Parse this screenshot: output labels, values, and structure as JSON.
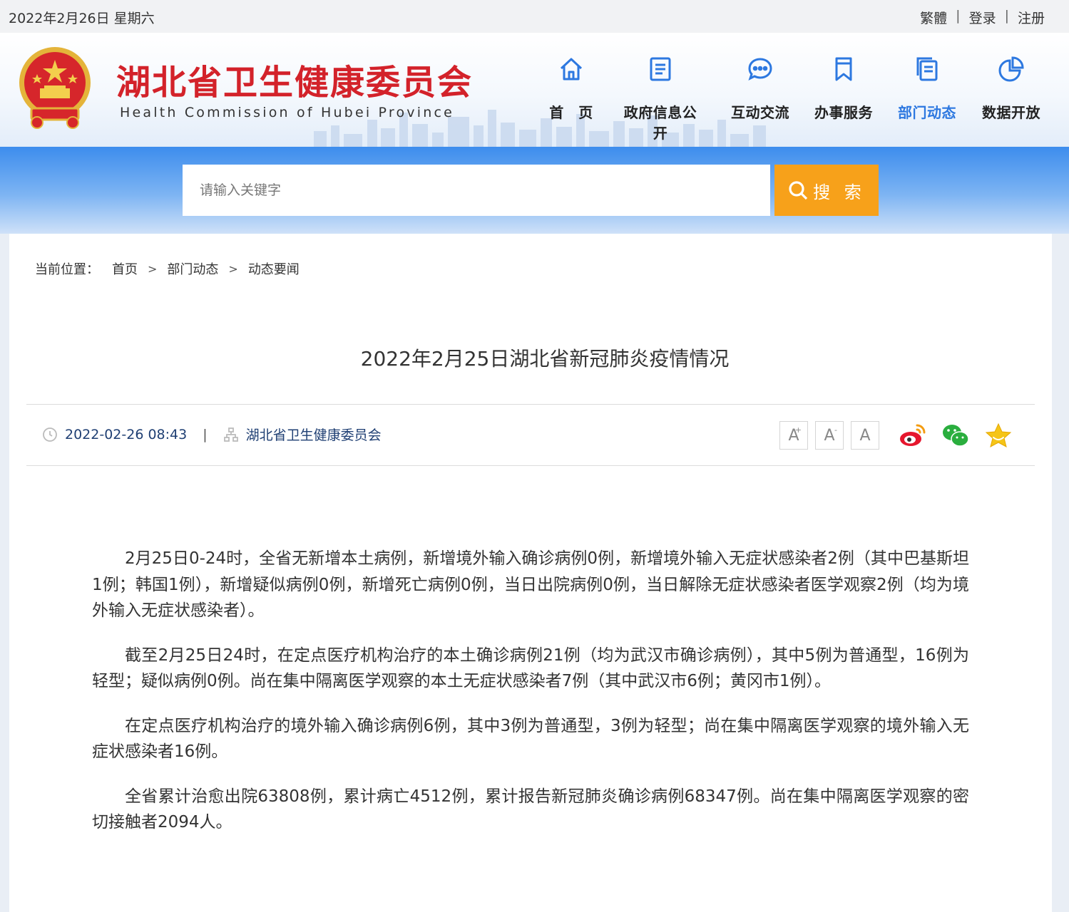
{
  "topbar": {
    "date": "2022年2月26日 星期六",
    "traditional": "繁體",
    "login": "登录",
    "register": "注册"
  },
  "header": {
    "title": "湖北省卫生健康委员会",
    "subtitle": "Health Commission of Hubei Province",
    "brand_color": "#d3222a",
    "nav": [
      {
        "label": "首　页",
        "icon": "home-icon"
      },
      {
        "label": "政府信息公开",
        "icon": "document-icon"
      },
      {
        "label": "互动交流",
        "icon": "chat-icon"
      },
      {
        "label": "办事服务",
        "icon": "bookmark-icon"
      },
      {
        "label": "部门动态",
        "icon": "pages-icon",
        "active": true
      },
      {
        "label": "数据开放",
        "icon": "pie-chart-icon"
      }
    ],
    "active_color": "#2d78e0"
  },
  "search": {
    "placeholder": "请输入关键字",
    "button_label": "搜 索",
    "button_color": "#f7a11a"
  },
  "breadcrumb": {
    "label": "当前位置：",
    "items": [
      "首页",
      "部门动态",
      "动态要闻"
    ]
  },
  "article": {
    "title": "2022年2月25日湖北省新冠肺炎疫情情况",
    "datetime": "2022-02-26 08:43",
    "source": "湖北省卫生健康委员会",
    "font_sizes": [
      "A",
      "A",
      "A"
    ],
    "paragraphs": [
      "2月25日0-24时，全省无新增本土病例，新增境外输入确诊病例0例，新增境外输入无症状感染者2例（其中巴基斯坦1例；韩国1例），新增疑似病例0例，新增死亡病例0例，当日出院病例0例，当日解除无症状感染者医学观察2例（均为境外输入无症状感染者）。",
      "截至2月25日24时，在定点医疗机构治疗的本土确诊病例21例（均为武汉市确诊病例），其中5例为普通型，16例为轻型；疑似病例0例。尚在集中隔离医学观察的本土无症状感染者7例（其中武汉市6例；黄冈市1例）。",
      "在定点医疗机构治疗的境外输入确诊病例6例，其中3例为普通型，3例为轻型；尚在集中隔离医学观察的境外输入无症状感染者16例。",
      "全省累计治愈出院63808例，累计病亡4512例，累计报告新冠肺炎确诊病例68347例。尚在集中隔离医学观察的密切接触者2094人。"
    ]
  }
}
